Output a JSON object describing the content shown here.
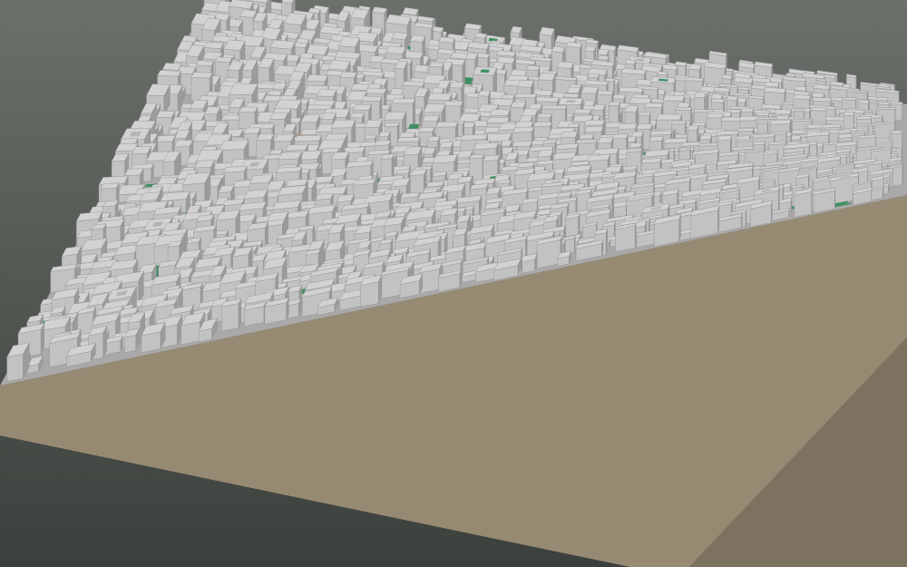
{
  "scene": {
    "subject": "city-block-3d-model",
    "colors": {
      "background_top": "#6c706b",
      "background_bottom": "#3c403c",
      "building_top": "#d2d2d2",
      "building_wall_light": "#c2c2c2",
      "building_wall_dark": "#9b9b9b",
      "building_edge": "#8e8e8e",
      "courtyard_floor": "#b4b4b4",
      "green_space": "#3f8f62",
      "ground_path": "#ae9e84",
      "terrain_side_front": "#978a73",
      "terrain_side_right": "#7d7260",
      "street": "#a9a9a9"
    }
  }
}
